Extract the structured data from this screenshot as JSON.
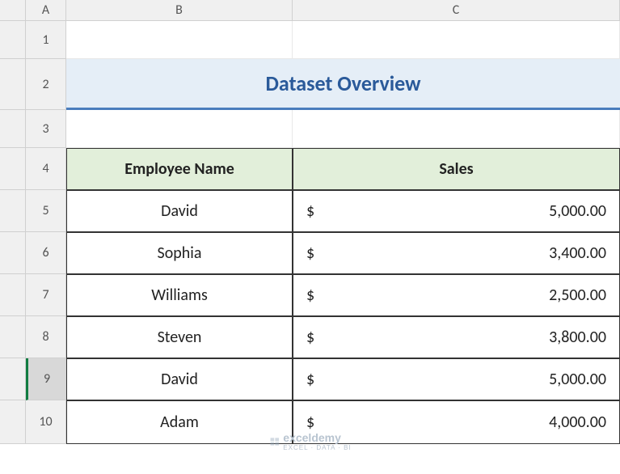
{
  "columns": [
    "A",
    "B",
    "C"
  ],
  "rows": [
    "1",
    "2",
    "3",
    "4",
    "5",
    "6",
    "7",
    "8",
    "9",
    "10"
  ],
  "selected_row": "9",
  "title": "Dataset Overview",
  "headers": {
    "employee": "Employee Name",
    "sales": "Sales"
  },
  "data": [
    {
      "name": "David",
      "currency": "$",
      "amount": "5,000.00"
    },
    {
      "name": "Sophia",
      "currency": "$",
      "amount": "3,400.00"
    },
    {
      "name": "Williams",
      "currency": "$",
      "amount": "2,500.00"
    },
    {
      "name": "Steven",
      "currency": "$",
      "amount": "3,800.00"
    },
    {
      "name": "David",
      "currency": "$",
      "amount": "5,000.00"
    },
    {
      "name": "Adam",
      "currency": "$",
      "amount": "4,000.00"
    }
  ],
  "watermark": {
    "brand": "exceldemy",
    "tagline": "EXCEL · DATA · BI"
  }
}
